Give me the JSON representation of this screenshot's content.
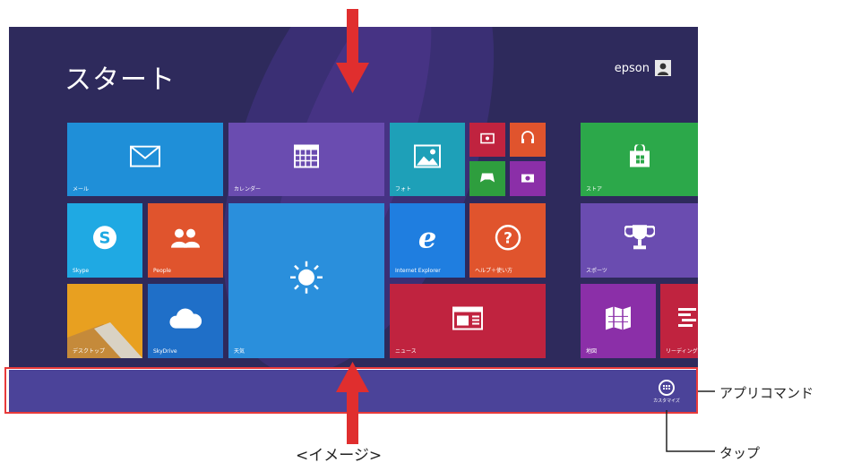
{
  "start": {
    "title": "スタート",
    "user": "epson"
  },
  "tiles": {
    "mail": "メール",
    "calendar": "カレンダー",
    "photos": "フォト",
    "store": "ストア",
    "skype": "Skype",
    "people": "People",
    "weather": "天気",
    "ie": "Internet Explorer",
    "help": "ヘルプ＋使い方",
    "sports": "スポーツ",
    "desktop": "デスクトップ",
    "skydrive": "SkyDrive",
    "news": "ニュース",
    "maps": "地図",
    "reading": "リーディング"
  },
  "appbar": {
    "customize_label": "カスタマイズ"
  },
  "annotations": {
    "app_command": "アプリコマンド",
    "tap": "タップ",
    "image_caption": "<イメージ>"
  },
  "colors": {
    "background": "#2e2a5c",
    "appbar": "#4b4399",
    "highlight": "#e83a3a",
    "arrow": "#e02e2e"
  }
}
